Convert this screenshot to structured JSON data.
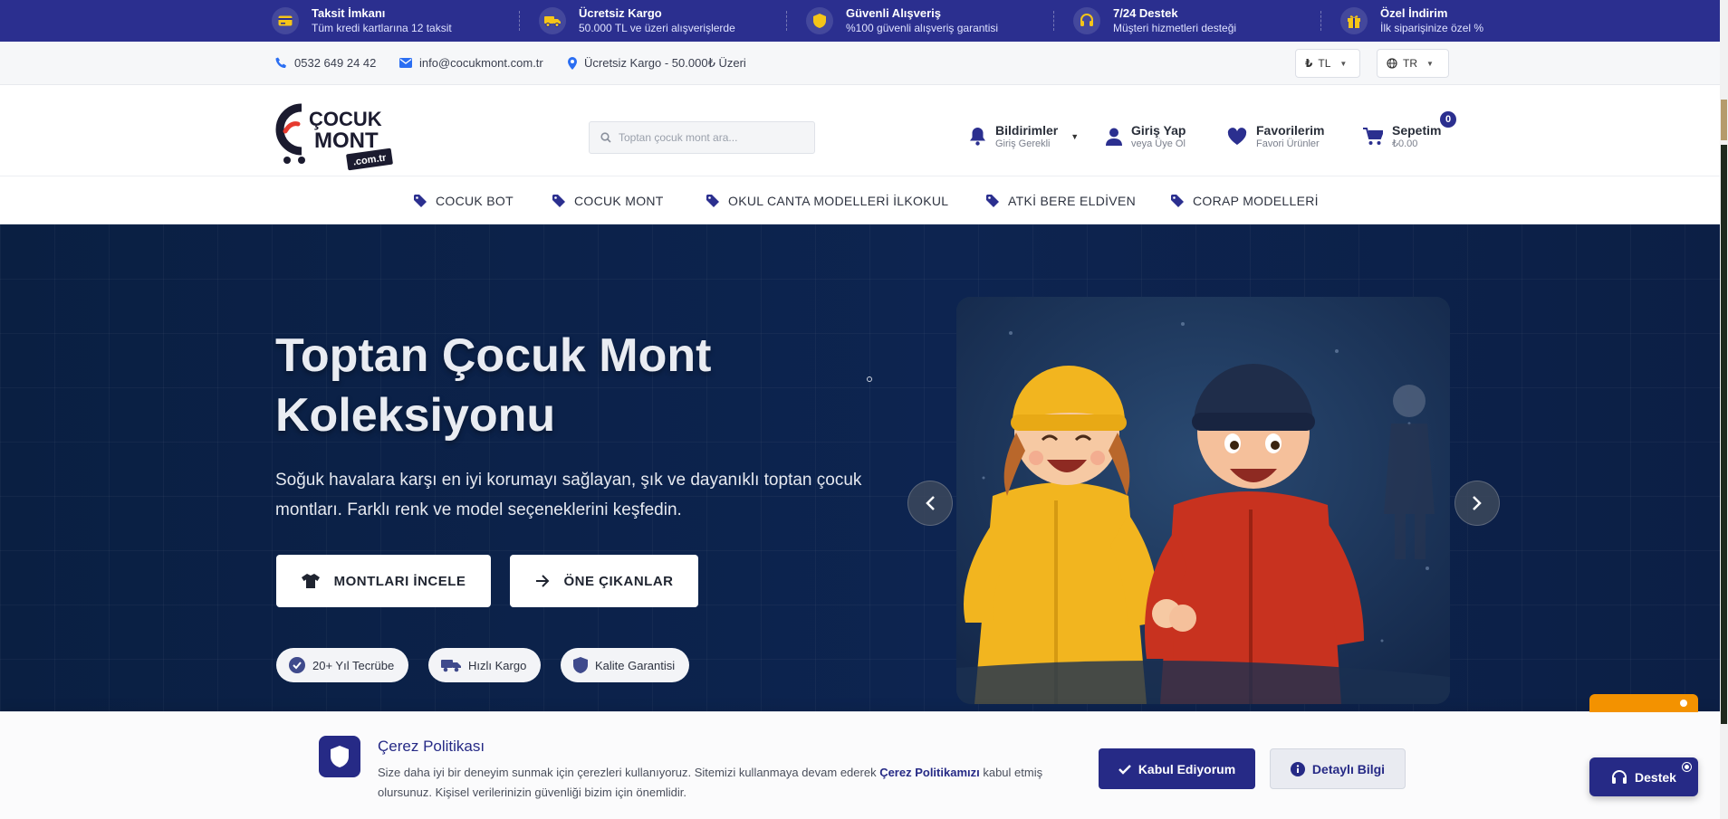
{
  "promo": [
    {
      "title": "Taksit İmkanı",
      "sub": "Tüm kredi kartlarına 12 taksit",
      "icon": "credit-card-icon"
    },
    {
      "title": "Ücretsiz Kargo",
      "sub": "50.000 TL ve üzeri alışverişlerde",
      "icon": "truck-icon"
    },
    {
      "title": "Güvenli Alışveriş",
      "sub": "%100 güvenli alışveriş garantisi",
      "icon": "shield-icon"
    },
    {
      "title": "7/24 Destek",
      "sub": "Müşteri hizmetleri desteği",
      "icon": "headset-icon"
    },
    {
      "title": "Özel İndirim",
      "sub": "İlk siparişinize özel %",
      "icon": "gift-icon"
    }
  ],
  "contact": {
    "phone": "0532 649 24 42",
    "email": "info@cocukmont.com.tr",
    "shipping": "Ücretsiz Kargo - 50.000₺ Üzeri",
    "currency_symbol": "₺",
    "currency": "TL",
    "language": "TR"
  },
  "header": {
    "logo_line1": "ÇOCUK",
    "logo_line2": "MONT",
    "logo_domain": ".com.tr",
    "search_placeholder": "Toptan çocuk mont ara...",
    "notifications_label": "Bildirimler",
    "notifications_sub": "Giriş Gerekli",
    "login_label": "Giriş Yap",
    "login_sub": "veya Üye Ol",
    "favorites_label": "Favorilerim",
    "favorites_sub": "Favori Ürünler",
    "cart_label": "Sepetim",
    "cart_total": "₺0.00",
    "cart_count": "0"
  },
  "categories": [
    "COCUK BOT",
    "COCUK MONT",
    "OKUL CANTA MODELLERİ İLKOKUL",
    "ATKİ BERE ELDİVEN",
    "CORAP MODELLERİ"
  ],
  "hero": {
    "title": "Toptan Çocuk Mont Koleksiyonu",
    "description": "Soğuk havalara karşı en iyi korumayı sağlayan, şık ve dayanıklı toptan çocuk montları. Farklı renk ve model seçeneklerini keşfedin.",
    "btn_primary": "MONTLARI İNCELE",
    "btn_secondary": "ÖNE ÇIKANLAR",
    "badges": [
      "20+ Yıl Tecrübe",
      "Hızlı Kargo",
      "Kalite Garantisi"
    ]
  },
  "cookie": {
    "title": "Çerez Politikası",
    "text_before": "Size daha iyi bir deneyim sunmak için çerezleri kullanıyoruz. Sitemizi kullanmaya devam ederek ",
    "link": "Çerez Politikamızı",
    "text_after": " kabul etmiş olursunuz. Kişisel verilerinizin güvenliği bizim için önemlidir.",
    "accept": "Kabul Ediyorum",
    "info": "Detaylı Bilgi"
  },
  "support_label": "Destek",
  "colors": {
    "brand": "#2b2f8f",
    "hero_bg": "#0d2450",
    "accent_orange": "#f39200"
  }
}
